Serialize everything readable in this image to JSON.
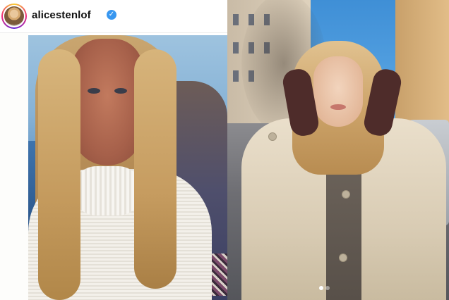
{
  "profile": {
    "username": "alicestenlof",
    "verified_badge_icon": "check-icon",
    "verified_color": "#3897f0"
  },
  "carousel": {
    "total": 2,
    "active": 1
  }
}
